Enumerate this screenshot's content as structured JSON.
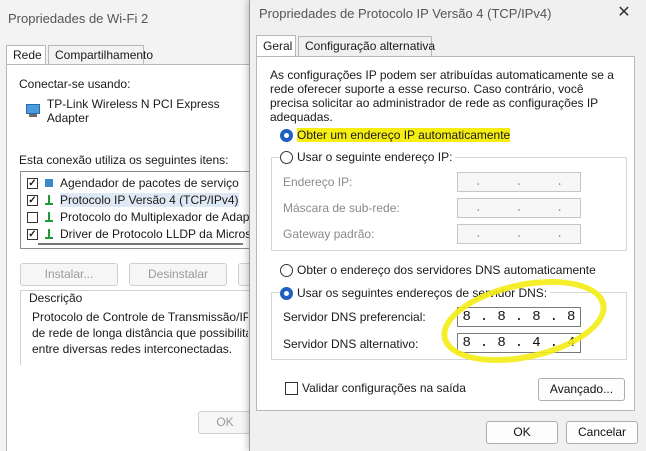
{
  "wifi": {
    "title": "Propriedades de Wi-Fi 2",
    "tabs": [
      "Rede",
      "Compartilhamento"
    ],
    "connect_label": "Conectar-se usando:",
    "adapter": "TP-Link Wireless N PCI Express Adapter",
    "items_label": "Esta conexão utiliza os seguintes itens:",
    "items": [
      {
        "label": "Agendador de pacotes de serviço",
        "checked": true
      },
      {
        "label": "Protocolo IP Versão 4 (TCP/IPv4)",
        "checked": true
      },
      {
        "label": "Protocolo do Multiplexador de Adaptado",
        "checked": false
      },
      {
        "label": "Driver de Protocolo LLDP da Microsoft",
        "checked": true
      }
    ],
    "install": "Instalar...",
    "uninstall": "Desinstalar",
    "description_title": "Descrição",
    "description": "Protocolo de Controle de Transmissão/IP. Prot\nde rede de longa distância que possibilita a co\nentre diversas redes interconectadas.",
    "ok": "OK"
  },
  "ipv4": {
    "title": "Propriedades de Protocolo IP Versão 4 (TCP/IPv4)",
    "tabs": [
      "Geral",
      "Configuração alternativa"
    ],
    "intro": "As configurações IP podem ser atribuídas automaticamente se a rede oferecer suporte a esse recurso. Caso contrário, você precisa solicitar ao administrador de rede as configurações IP adequadas.",
    "ip_auto": "Obter um endereço IP automaticamente",
    "ip_manual": "Usar o seguinte endereço IP:",
    "ip_address_label": "Endereço IP:",
    "subnet_label": "Máscara de sub-rede:",
    "gateway_label": "Gateway padrão:",
    "dns_auto": "Obter o endereço dos servidores DNS automaticamente",
    "dns_manual": "Usar os seguintes endereços de servidor DNS:",
    "dns_preferred_label": "Servidor DNS preferencial:",
    "dns_alternate_label": "Servidor DNS alternativo:",
    "dns_preferred": [
      "8",
      "8",
      "8",
      "8"
    ],
    "dns_alternate": [
      "8",
      "8",
      "4",
      "4"
    ],
    "validate_label": "Validar configurações na saída",
    "advanced": "Avançado...",
    "ok": "OK",
    "cancel": "Cancelar",
    "highlight_color": "#f6ee13"
  }
}
